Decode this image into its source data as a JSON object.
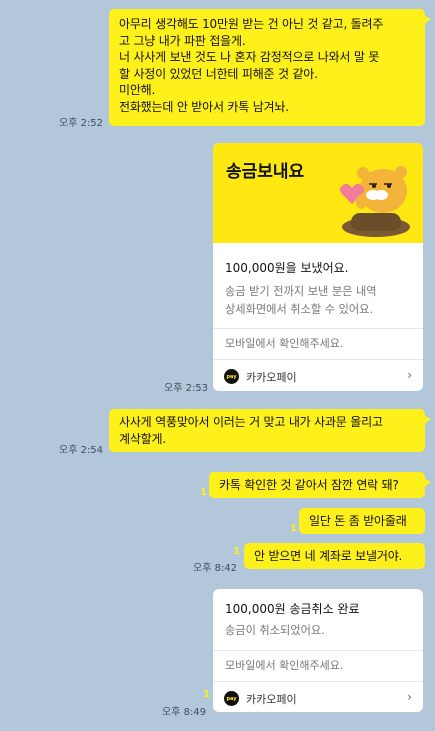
{
  "colors": {
    "background": "#b2c7d9",
    "bubble": "#fef01b",
    "card_header": "#ffe812"
  },
  "messages": [
    {
      "lines": [
        "아무리 생각해도 10만원 받는 건 아닌 것 같고, 돌려주",
        "고 그냥 내가 파판 접을게.",
        "너 사사게 보낸 것도 나 혼자 감정적으로 나와서 말 못",
        "할 사정이 있었던 너한테 피해준 것 같아.",
        "미안해.",
        "전화했는데 안 받아서 카톡 남겨놔."
      ],
      "time": "오후 2:52"
    },
    {
      "time": "오후 2:53"
    },
    {
      "lines": [
        "사사게 역풍맞아서 이러는 거 맞고 내가 사과문 올리고",
        "계삭할게."
      ],
      "time": "오후 2:54"
    },
    {
      "text": "카톡 확인한 것 같아서 잠깐 연락 돼?",
      "read": "1"
    },
    {
      "text": "일단 돈 좀 받아줄래",
      "read": "1"
    },
    {
      "text": "안 받으면 네 계좌로 보낼거야.",
      "read": "1",
      "time": "오후 8:42"
    },
    {
      "read": "1",
      "time": "오후 8:49"
    }
  ],
  "send_card": {
    "title": "송금보내요",
    "amount_text": "100,000원을 보냈어요.",
    "desc_lines": [
      "송금 받기 전까지 보낸 분은 내역",
      "상세화면에서 취소할 수 있어요."
    ],
    "mobile_note": "모바일에서 확인해주세요.",
    "pay_icon_text": "pay",
    "pay_label": "카카오페이",
    "chevron": "›",
    "sticker": "ryan-heart-sticker"
  },
  "cancel_card": {
    "amount_text": "100,000원 송금취소 완료",
    "desc": "송금이 취소되었어요.",
    "mobile_note": "모바일에서 확인해주세요.",
    "pay_icon_text": "pay",
    "pay_label": "카카오페이",
    "chevron": "›"
  }
}
